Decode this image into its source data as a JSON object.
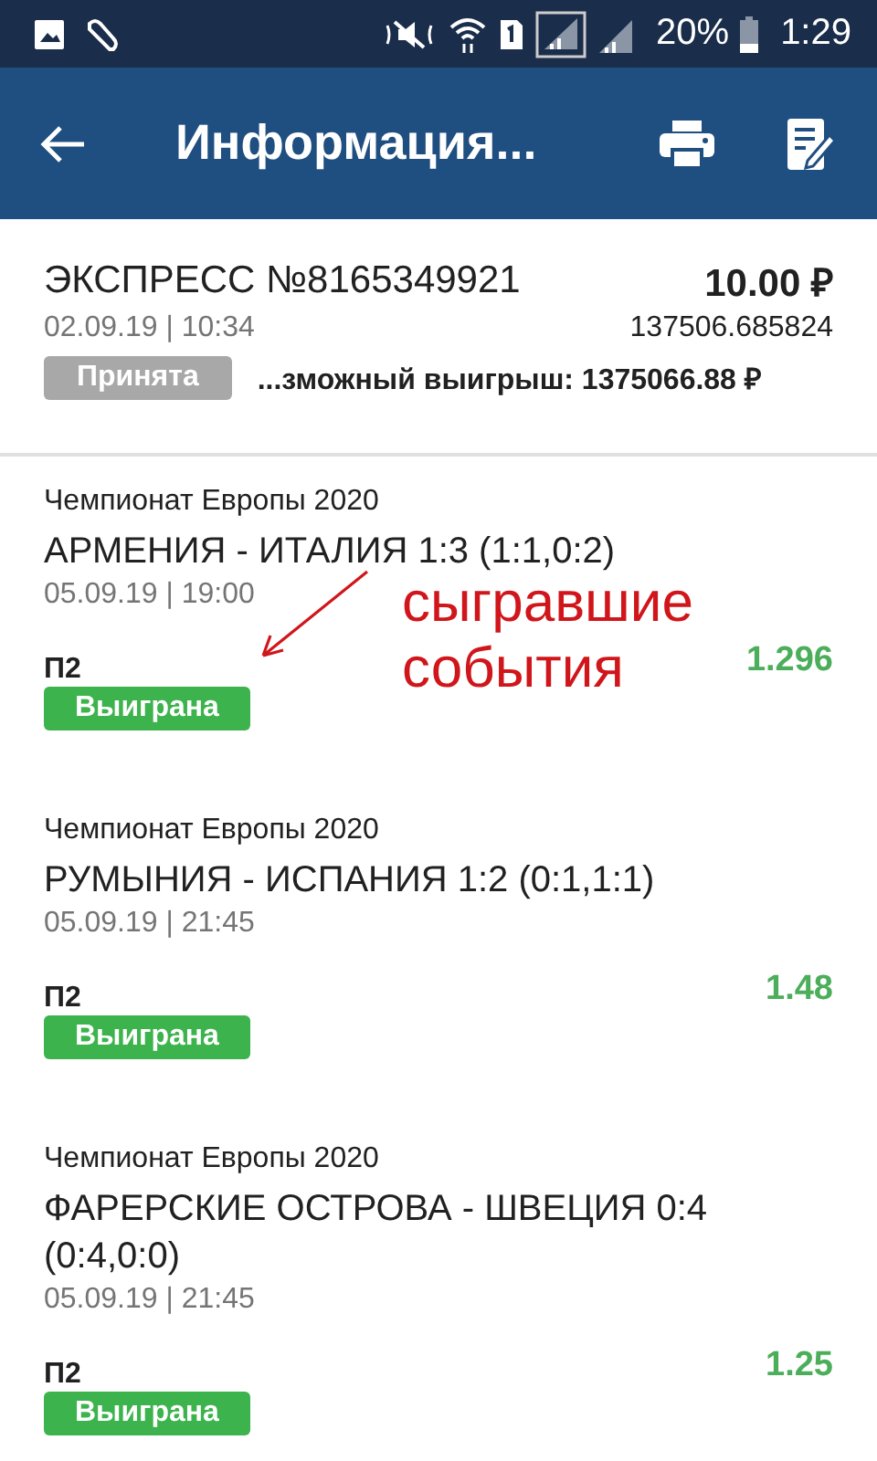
{
  "status_bar": {
    "battery": "20%",
    "time": "1:29"
  },
  "header": {
    "title": "Информация..."
  },
  "bet": {
    "title": "ЭКСПРЕСС №8165349921",
    "amount": "10.00 ₽",
    "datetime": "02.09.19 | 10:34",
    "coefficient": "137506.685824",
    "status": {
      "label": "Принята",
      "kind": "pending"
    },
    "possible_win": "...зможный выигрыш: 1375066.88 ₽"
  },
  "events": [
    {
      "league": "Чемпионат Европы 2020",
      "match": "АРМЕНИЯ - ИТАЛИЯ 1:3 (1:1,0:2)",
      "datetime": "05.09.19 | 19:00",
      "outcome": "П2",
      "odds": "1.296",
      "status": {
        "label": "Выиграна",
        "kind": "won"
      }
    },
    {
      "league": "Чемпионат Европы 2020",
      "match": "РУМЫНИЯ - ИСПАНИЯ 1:2 (0:1,1:1)",
      "datetime": "05.09.19 | 21:45",
      "outcome": "П2",
      "odds": "1.48",
      "status": {
        "label": "Выиграна",
        "kind": "won"
      }
    },
    {
      "league": "Чемпионат Европы 2020",
      "match": "ФАРЕРСКИЕ ОСТРОВА - ШВЕЦИЯ 0:4 (0:4,0:0)",
      "datetime": "05.09.19 | 21:45",
      "outcome": "П2",
      "odds": "1.25",
      "status": {
        "label": "Выиграна",
        "kind": "won"
      }
    }
  ],
  "annotation": {
    "text": "сыгравшие события"
  }
}
